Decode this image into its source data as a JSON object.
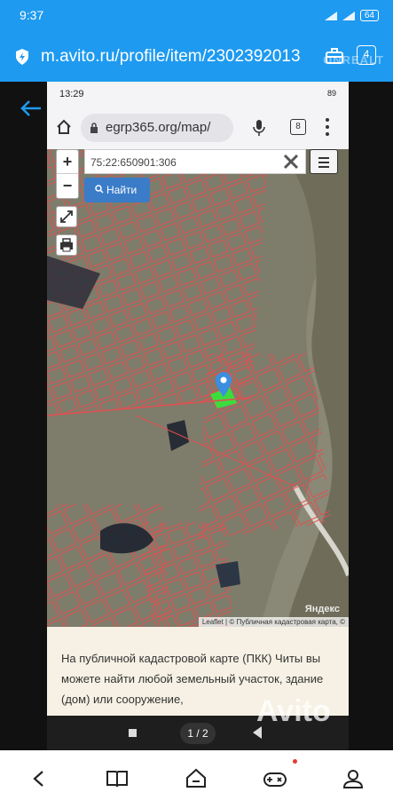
{
  "outer_status": {
    "time": "9:37",
    "battery": "64"
  },
  "outer_browser": {
    "url": "m.avito.ru/profile/item/2302392013",
    "tab_count": "4",
    "watermark": "ONREALT"
  },
  "inner_status": {
    "time": "13:29",
    "battery": "89"
  },
  "inner_browser": {
    "url": "egrp365.org/map/",
    "tab_count": "8"
  },
  "map": {
    "search_value": "75:22:650901:306",
    "find_button": "Найти",
    "zoom_in": "+",
    "zoom_out": "−",
    "attribution": "Leaflet | © Публичная кадастровая карта, ©",
    "yandex": "Яндекс"
  },
  "description": "На публичной кадастровой карте (ПКК) Читы вы можете найти любой земельный участок, здание (дом) или сооружение,",
  "viewer": {
    "counter": "1 / 2",
    "watermark": "Avito"
  },
  "colors": {
    "header_blue": "#1e9af0",
    "parcel_line": "#e05050",
    "find_button": "#3a7cc8",
    "selected_parcel": "#3ddc3d"
  }
}
